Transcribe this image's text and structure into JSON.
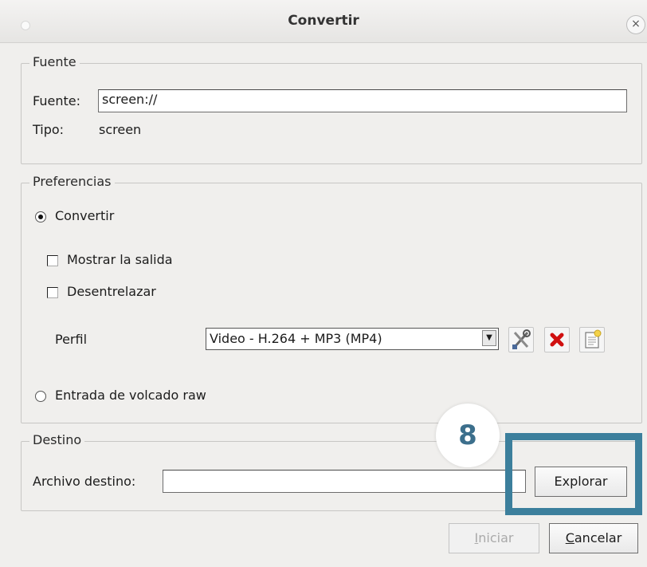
{
  "window": {
    "title": "Convertir",
    "close_glyph": "×"
  },
  "source": {
    "legend": "Fuente",
    "field_label": "Fuente:",
    "field_value": "screen://",
    "type_label": "Tipo:",
    "type_value": "screen"
  },
  "preferences": {
    "legend": "Preferencias",
    "convert_label": "Convertir",
    "convert_selected": true,
    "show_output_label": "Mostrar la salida",
    "show_output_checked": false,
    "deinterlace_label": "Desentrelazar",
    "deinterlace_checked": false,
    "profile_label": "Perfil",
    "profile_value": "Video - H.264 + MP3 (MP4)",
    "raw_dump_label": "Entrada de volcado raw",
    "raw_dump_selected": false
  },
  "destination": {
    "legend": "Destino",
    "file_label": "Archivo destino:",
    "file_value": "",
    "browse_label": "Explorar"
  },
  "footer": {
    "start_mnemonic": "I",
    "start_rest": "niciar",
    "start_enabled": false,
    "cancel_mnemonic": "C",
    "cancel_rest": "ancelar"
  },
  "annotation": {
    "step_number": "8",
    "color": "#3c7f9c"
  },
  "icons": {
    "edit_profile": "tools-icon",
    "delete_profile": "red-x-icon",
    "new_profile": "new-document-icon"
  }
}
